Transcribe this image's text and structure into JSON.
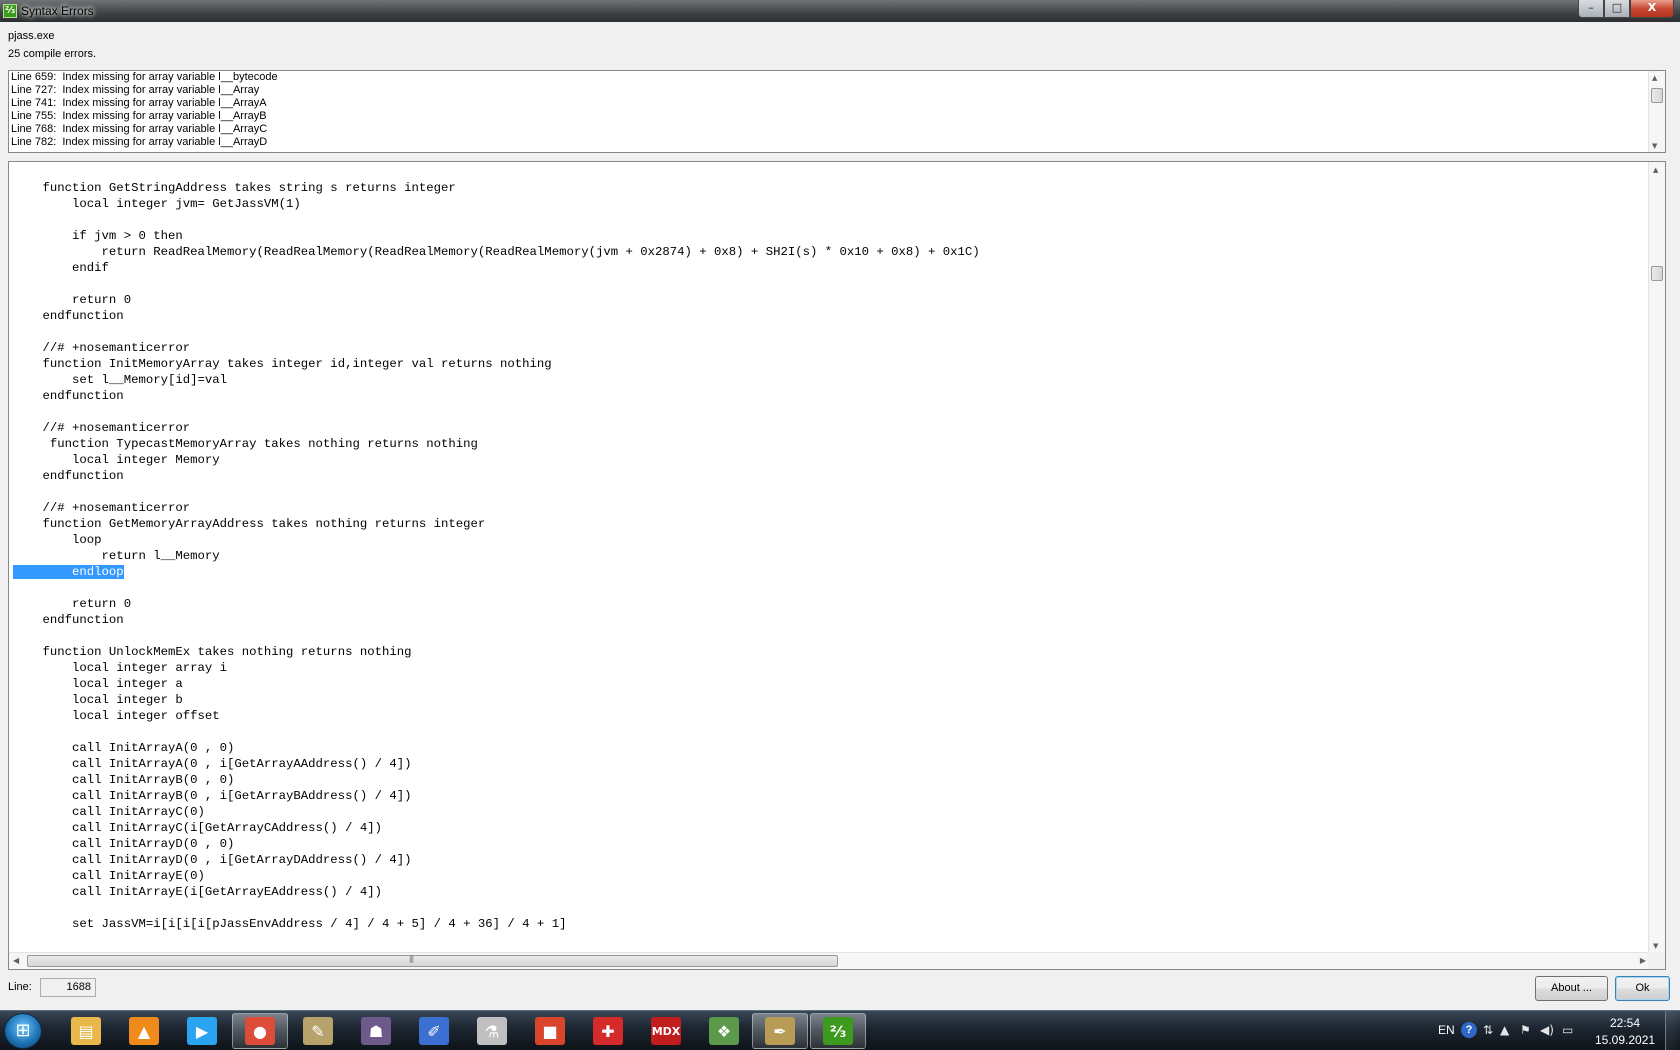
{
  "window": {
    "title": "Syntax Errors",
    "app_icon_glyph": "⅔",
    "minimize_glyph": "–",
    "maximize_glyph": "□",
    "close_glyph": "X"
  },
  "header": {
    "exe_name": "pjass.exe",
    "error_count": "25 compile errors."
  },
  "errors": [
    "Line 659:  Index missing for array variable l__bytecode",
    "Line 727:  Index missing for array variable l__Array",
    "Line 741:  Index missing for array variable l__ArrayA",
    "Line 755:  Index missing for array variable l__ArrayB",
    "Line 768:  Index missing for array variable l__ArrayC",
    "Line 782:  Index missing for array variable l__ArrayD"
  ],
  "code": {
    "lines": [
      "    function GetStringAddress takes string s returns integer",
      "        local integer jvm= GetJassVM(1)",
      "",
      "        if jvm > 0 then",
      "            return ReadRealMemory(ReadRealMemory(ReadRealMemory(ReadRealMemory(jvm + 0x2874) + 0x8) + SH2I(s) * 0x10 + 0x8) + 0x1C)",
      "        endif",
      "",
      "        return 0",
      "    endfunction",
      "",
      "    //# +nosemanticerror",
      "    function InitMemoryArray takes integer id,integer val returns nothing",
      "        set l__Memory[id]=val",
      "    endfunction",
      "",
      "    //# +nosemanticerror",
      "     function TypecastMemoryArray takes nothing returns nothing",
      "        local integer Memory",
      "    endfunction",
      "",
      "    //# +nosemanticerror",
      "    function GetMemoryArrayAddress takes nothing returns integer",
      "        loop",
      "            return l__Memory",
      "        endloop",
      "",
      "        return 0",
      "    endfunction",
      "",
      "    function UnlockMemEx takes nothing returns nothing",
      "        local integer array i",
      "        local integer a",
      "        local integer b",
      "        local integer offset",
      "",
      "        call InitArrayA(0 , 0)",
      "        call InitArrayA(0 , i[GetArrayAAddress() / 4])",
      "        call InitArrayB(0 , 0)",
      "        call InitArrayB(0 , i[GetArrayBAddress() / 4])",
      "        call InitArrayC(0)",
      "        call InitArrayC(i[GetArrayCAddress() / 4])",
      "        call InitArrayD(0 , 0)",
      "        call InitArrayD(0 , i[GetArrayDAddress() / 4])",
      "        call InitArrayE(0)",
      "        call InitArrayE(i[GetArrayEAddress() / 4])",
      "",
      "        set JassVM=i[i[i[i[pJassEnvAddress / 4] / 4 + 5] / 4 + 36] / 4 + 1]"
    ],
    "selected_line_index": 24
  },
  "footer": {
    "line_label": "Line:",
    "line_value": "1688",
    "about_label": "About ...",
    "ok_label": "Ok"
  },
  "taskbar": {
    "apps": [
      {
        "name": "explorer-icon",
        "glyph": "▤",
        "color": "#e8b84a",
        "active": false
      },
      {
        "name": "aimp-icon",
        "glyph": "▲",
        "color": "#f08a1a",
        "active": false
      },
      {
        "name": "media-player-icon",
        "glyph": "▶",
        "color": "#2aa3f0",
        "active": false
      },
      {
        "name": "chrome-icon",
        "glyph": "●",
        "color": "#dd4b39",
        "active": true
      },
      {
        "name": "scroll-editor-icon",
        "glyph": "✎",
        "color": "#b7a26b",
        "active": false
      },
      {
        "name": "warcraft-icon",
        "glyph": "☗",
        "color": "#6d5a8a",
        "active": false
      },
      {
        "name": "image-editor-icon",
        "glyph": "✐",
        "color": "#3b6fd1",
        "active": false
      },
      {
        "name": "flask-icon",
        "glyph": "⚗",
        "color": "#c0c0c0",
        "active": false
      },
      {
        "name": "blocks-icon",
        "glyph": "■",
        "color": "#d9452b",
        "active": false
      },
      {
        "name": "model-viewer-icon",
        "glyph": "✚",
        "color": "#d42a2a",
        "active": false
      },
      {
        "name": "mdx-icon",
        "glyph": "MDX",
        "color": "#c21d1d",
        "active": false
      },
      {
        "name": "rune-icon",
        "glyph": "❖",
        "color": "#5a9a4a",
        "active": false
      },
      {
        "name": "world-editor-icon",
        "glyph": "✒",
        "color": "#b89b55",
        "active": true
      },
      {
        "name": "jass-helper-icon",
        "glyph": "⅔",
        "color": "#3d9a1f",
        "active": true
      }
    ],
    "tray": {
      "language": "EN",
      "help_glyph": "?",
      "time": "22:54",
      "date": "15.09.2021"
    }
  }
}
